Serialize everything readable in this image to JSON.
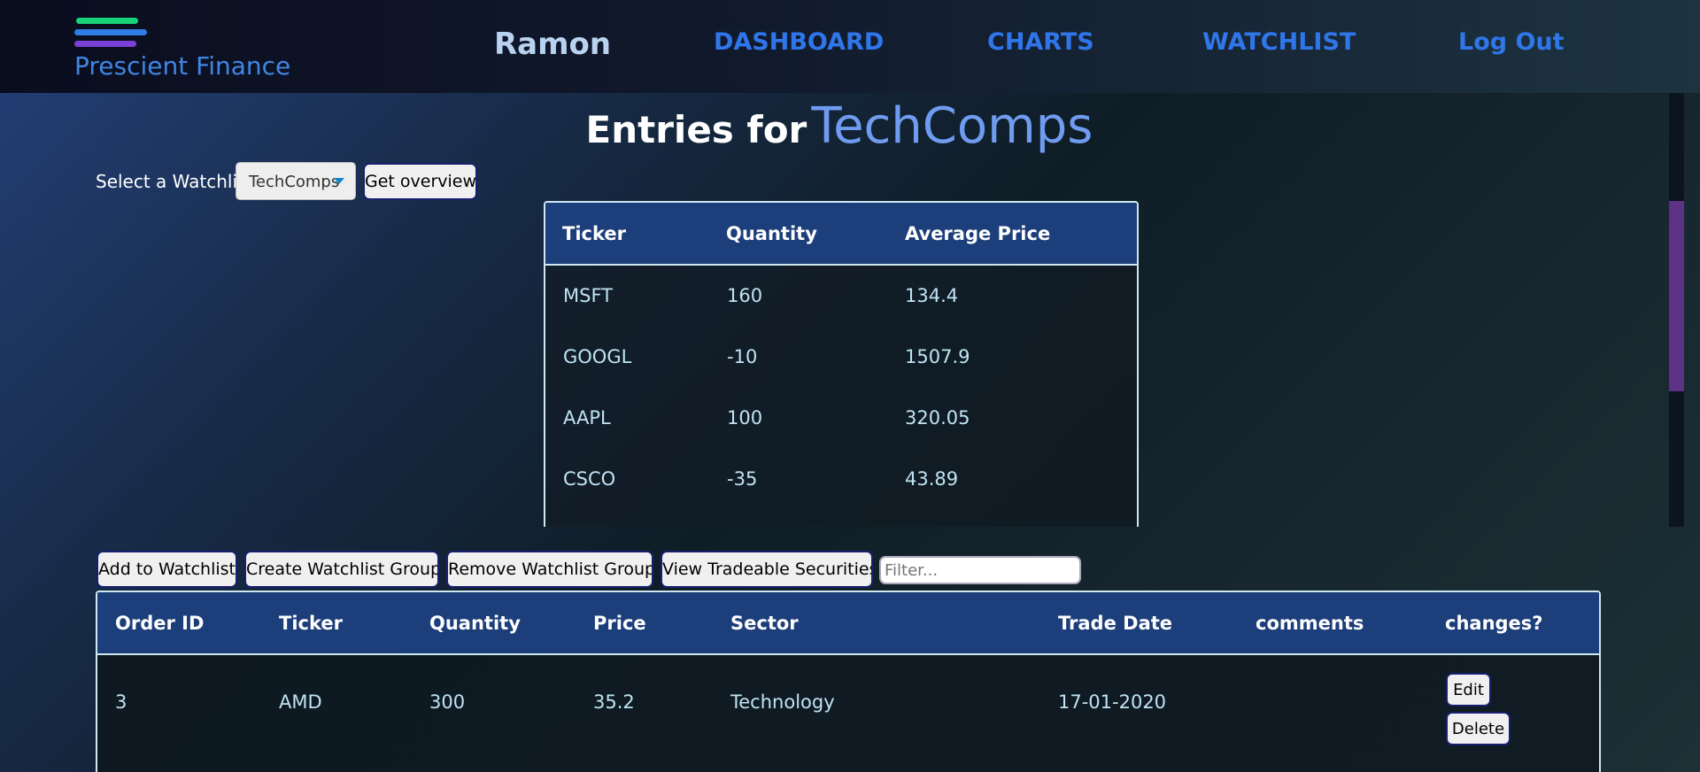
{
  "app": {
    "brand": "Prescient Finance"
  },
  "nav": {
    "user": "Ramon",
    "links": [
      "DASHBOARD",
      "CHARTS",
      "WATCHLIST",
      "Log Out"
    ]
  },
  "page": {
    "heading_prefix": "Entries for",
    "watchlist_name": "TechComps"
  },
  "controls": {
    "select_label": "Select a Watchlist",
    "select_value": "TechComps",
    "overview_button": "Get overview",
    "add_button": "Add to Watchlist",
    "create_group_button": "Create Watchlist Group",
    "remove_group_button": "Remove Watchlist Group",
    "view_securities_button": "View Tradeable Securities",
    "filter_placeholder": "Filter..."
  },
  "holdings": {
    "columns": [
      "Ticker",
      "Quantity",
      "Average Price"
    ],
    "rows": [
      [
        "MSFT",
        "160",
        "134.4"
      ],
      [
        "GOOGL",
        "-10",
        "1507.9"
      ],
      [
        "AAPL",
        "100",
        "320.05"
      ],
      [
        "CSCO",
        "-35",
        "43.89"
      ]
    ]
  },
  "orders": {
    "columns": [
      "Order ID",
      "Ticker",
      "Quantity",
      "Price",
      "Sector",
      "Trade Date",
      "comments",
      "changes?"
    ],
    "rows": [
      {
        "id": "3",
        "ticker": "AMD",
        "quantity": "300",
        "price": "35.2",
        "sector": "Technology",
        "trade_date": "17-01-2020",
        "comments": "",
        "edit_label": "Edit",
        "delete_label": "Delete"
      }
    ]
  },
  "colors": {
    "accent": "#2f76ea",
    "table_header": "#1c3e7a",
    "heading_highlight": "#6f9cf0"
  }
}
